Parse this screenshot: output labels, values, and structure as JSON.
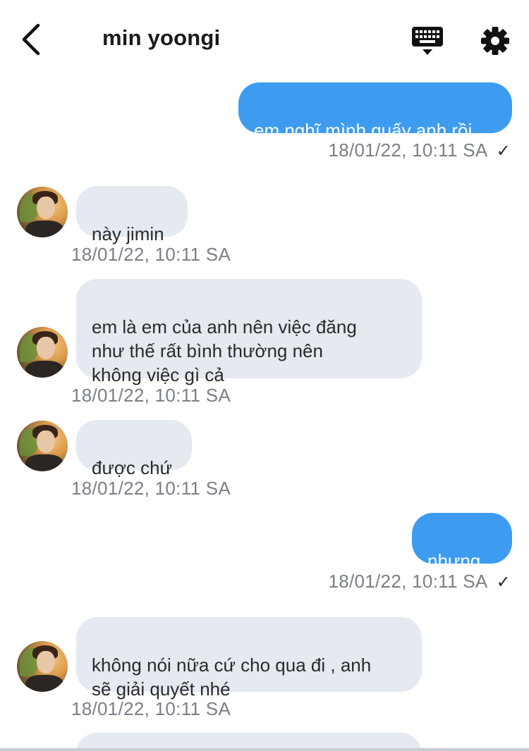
{
  "header": {
    "title": "min yoongi"
  },
  "messages": [
    {
      "dir": "out",
      "text": "em nghĩ mình quấy anh rồi",
      "time": "18/01/22, 10:11 SA",
      "check": "✓"
    },
    {
      "dir": "in",
      "text": "này jimin",
      "time": "18/01/22, 10:11 SA"
    },
    {
      "dir": "in",
      "text": "em là em của anh nên việc đăng\nnhư thế rất bình thường nên\nkhông việc gì cả",
      "time": "18/01/22, 10:11 SA"
    },
    {
      "dir": "in",
      "text": "được chứ",
      "time": "18/01/22, 10:11 SA"
    },
    {
      "dir": "out",
      "text": "nhưng..",
      "time": "18/01/22, 10:11 SA",
      "check": "✓"
    },
    {
      "dir": "in",
      "text": "không nói nữa cứ cho qua đi , anh\nsẽ giải quyết nhé",
      "time": "18/01/22, 10:11 SA"
    },
    {
      "dir": "in",
      "text": "",
      "time": ""
    }
  ],
  "colors": {
    "outgoing_bubble": "#3d9cf0",
    "incoming_bubble": "#e5e9f0",
    "timestamp": "#7a7f88"
  },
  "icons": {
    "back": "chevron-left-icon",
    "keyboard": "keyboard-icon",
    "settings": "gear-icon",
    "read_receipt": "check-icon"
  }
}
